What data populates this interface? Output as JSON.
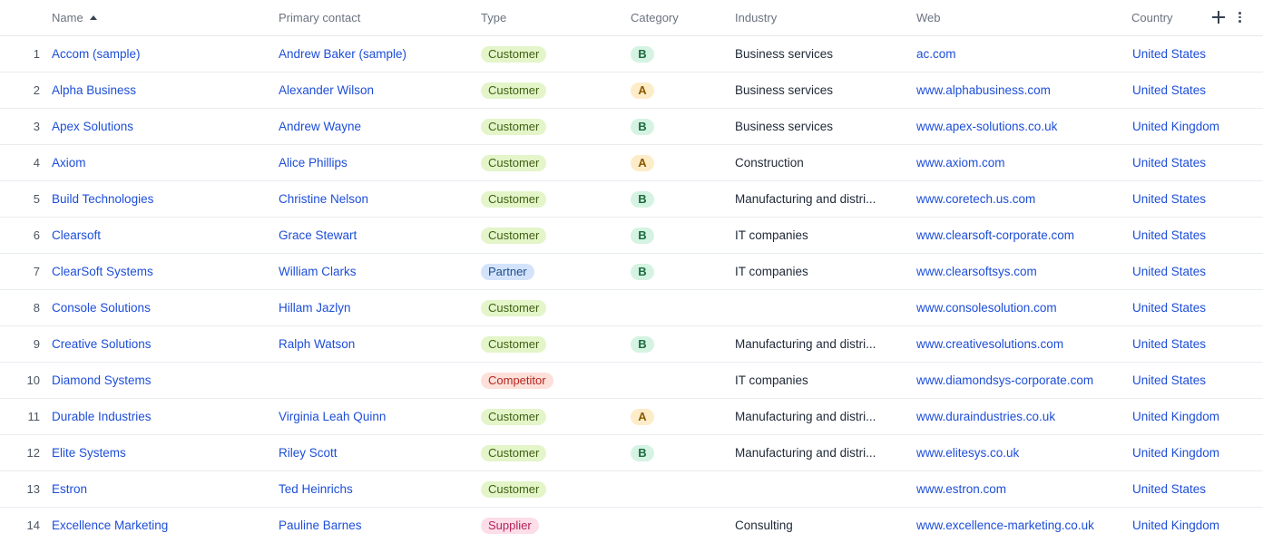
{
  "columns": {
    "name": "Name",
    "primary_contact": "Primary contact",
    "type": "Type",
    "category": "Category",
    "industry": "Industry",
    "web": "Web",
    "country": "Country"
  },
  "icons": {
    "sort": "sort-ascending-icon",
    "add": "plus-icon",
    "more": "kebab-menu-icon"
  },
  "type_colors": {
    "Customer": {
      "bg": "#e3f5c9",
      "fg": "#3f5f12"
    },
    "Partner": {
      "bg": "#d3e3fb",
      "fg": "#1e4e8c"
    },
    "Competitor": {
      "bg": "#fde0da",
      "fg": "#b3261e"
    },
    "Supplier": {
      "bg": "#fcdde8",
      "fg": "#b4235a"
    }
  },
  "category_colors": {
    "A": {
      "bg": "#fdecc8",
      "fg": "#8a5a00"
    },
    "B": {
      "bg": "#d5f3e2",
      "fg": "#1d6b3f"
    }
  },
  "rows": [
    {
      "num": "1",
      "name": "Accom (sample)",
      "contact": "Andrew Baker (sample)",
      "type": "Customer",
      "category": "B",
      "industry": "Business services",
      "web": "ac.com",
      "country": "United States"
    },
    {
      "num": "2",
      "name": "Alpha Business",
      "contact": "Alexander Wilson",
      "type": "Customer",
      "category": "A",
      "industry": "Business services",
      "web": "www.alphabusiness.com",
      "country": "United States"
    },
    {
      "num": "3",
      "name": "Apex Solutions",
      "contact": "Andrew Wayne",
      "type": "Customer",
      "category": "B",
      "industry": "Business services",
      "web": "www.apex-solutions.co.uk",
      "country": "United Kingdom"
    },
    {
      "num": "4",
      "name": "Axiom",
      "contact": "Alice Phillips",
      "type": "Customer",
      "category": "A",
      "industry": "Construction",
      "web": "www.axiom.com",
      "country": "United States"
    },
    {
      "num": "5",
      "name": "Build Technologies",
      "contact": "Christine Nelson",
      "type": "Customer",
      "category": "B",
      "industry": "Manufacturing and distri...",
      "web": "www.coretech.us.com",
      "country": "United States"
    },
    {
      "num": "6",
      "name": "Clearsoft",
      "contact": "Grace Stewart",
      "type": "Customer",
      "category": "B",
      "industry": "IT companies",
      "web": "www.clearsoft-corporate.com",
      "country": "United States"
    },
    {
      "num": "7",
      "name": "ClearSoft Systems",
      "contact": "William Clarks",
      "type": "Partner",
      "category": "B",
      "industry": "IT companies",
      "web": "www.clearsoftsys.com",
      "country": "United States"
    },
    {
      "num": "8",
      "name": "Console Solutions",
      "contact": "Hillam Jazlyn",
      "type": "Customer",
      "category": "",
      "industry": "",
      "web": "www.consolesolution.com",
      "country": "United States"
    },
    {
      "num": "9",
      "name": "Creative Solutions",
      "contact": "Ralph Watson",
      "type": "Customer",
      "category": "B",
      "industry": "Manufacturing and distri...",
      "web": "www.creativesolutions.com",
      "country": "United States"
    },
    {
      "num": "10",
      "name": "Diamond Systems",
      "contact": "",
      "type": "Competitor",
      "category": "",
      "industry": "IT companies",
      "web": "www.diamondsys-corporate.com",
      "country": "United States"
    },
    {
      "num": "11",
      "name": "Durable Industries",
      "contact": "Virginia Leah Quinn",
      "type": "Customer",
      "category": "A",
      "industry": "Manufacturing and distri...",
      "web": "www.duraindustries.co.uk",
      "country": "United Kingdom"
    },
    {
      "num": "12",
      "name": "Elite Systems",
      "contact": "Riley Scott",
      "type": "Customer",
      "category": "B",
      "industry": "Manufacturing and distri...",
      "web": "www.elitesys.co.uk",
      "country": "United Kingdom"
    },
    {
      "num": "13",
      "name": "Estron",
      "contact": "Ted Heinrichs",
      "type": "Customer",
      "category": "",
      "industry": "",
      "web": "www.estron.com",
      "country": "United States"
    },
    {
      "num": "14",
      "name": "Excellence Marketing",
      "contact": "Pauline Barnes",
      "type": "Supplier",
      "category": "",
      "industry": "Consulting",
      "web": "www.excellence-marketing.co.uk",
      "country": "United Kingdom"
    }
  ]
}
